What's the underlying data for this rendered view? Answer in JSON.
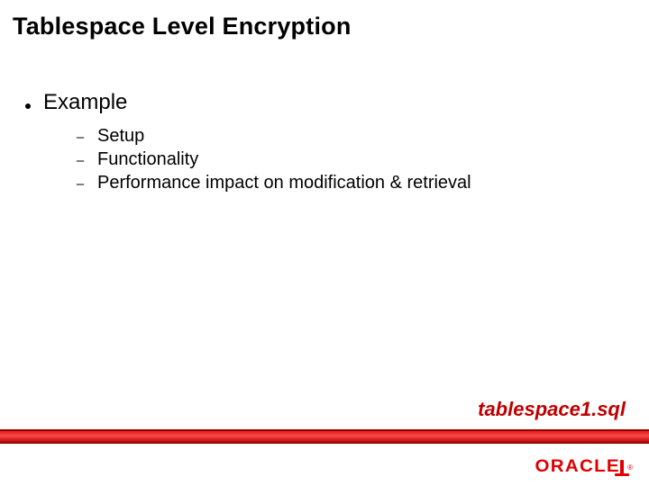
{
  "title": "Tablespace Level Encryption",
  "bullets": [
    {
      "text": "Example",
      "subitems": [
        "Setup",
        "Functionality",
        "Performance impact on modification & retrieval"
      ]
    }
  ],
  "footer_label": "tablespace1.sql",
  "logo_text": "ORACLE",
  "logo_reg": "®"
}
